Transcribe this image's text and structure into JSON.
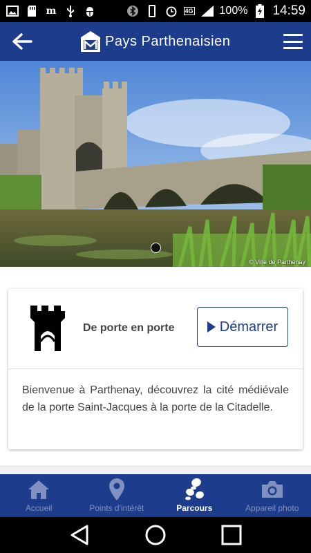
{
  "status_bar": {
    "battery_percent": "100%",
    "time": "14:59",
    "network": "4G",
    "icons": [
      "image-icon",
      "sd-card-icon",
      "m-icon",
      "usb-icon",
      "android-debug-icon",
      "bluetooth-icon",
      "vibrate-icon",
      "alarm-icon",
      "signal-icon",
      "battery-charging-icon"
    ]
  },
  "app_bar": {
    "title": "Pays Parthenaisien",
    "back_icon": "arrow-left-icon",
    "menu_icon": "hamburger-menu-icon"
  },
  "hero": {
    "photo_credit": "© Ville de Parthenay",
    "carousel_pages": 1,
    "active_page": 1
  },
  "card": {
    "title": "De porte en porte",
    "start_label": "Démarrer",
    "description": "Bienvenue à Parthenay, découvrez la cité médiévale de la porte Saint-Jacques à la porte de la Citadelle."
  },
  "bottom_nav": {
    "items": [
      {
        "label": "Accueil",
        "icon": "home-icon",
        "active": false
      },
      {
        "label": "Points d'intérêt",
        "icon": "map-pin-icon",
        "active": false
      },
      {
        "label": "Parcours",
        "icon": "footprints-icon",
        "active": true
      },
      {
        "label": "Appareil photo",
        "icon": "camera-icon",
        "active": false
      }
    ]
  },
  "colors": {
    "primary": "#1d3c8b",
    "nav_inactive": "#8190c0",
    "text": "#444444"
  }
}
